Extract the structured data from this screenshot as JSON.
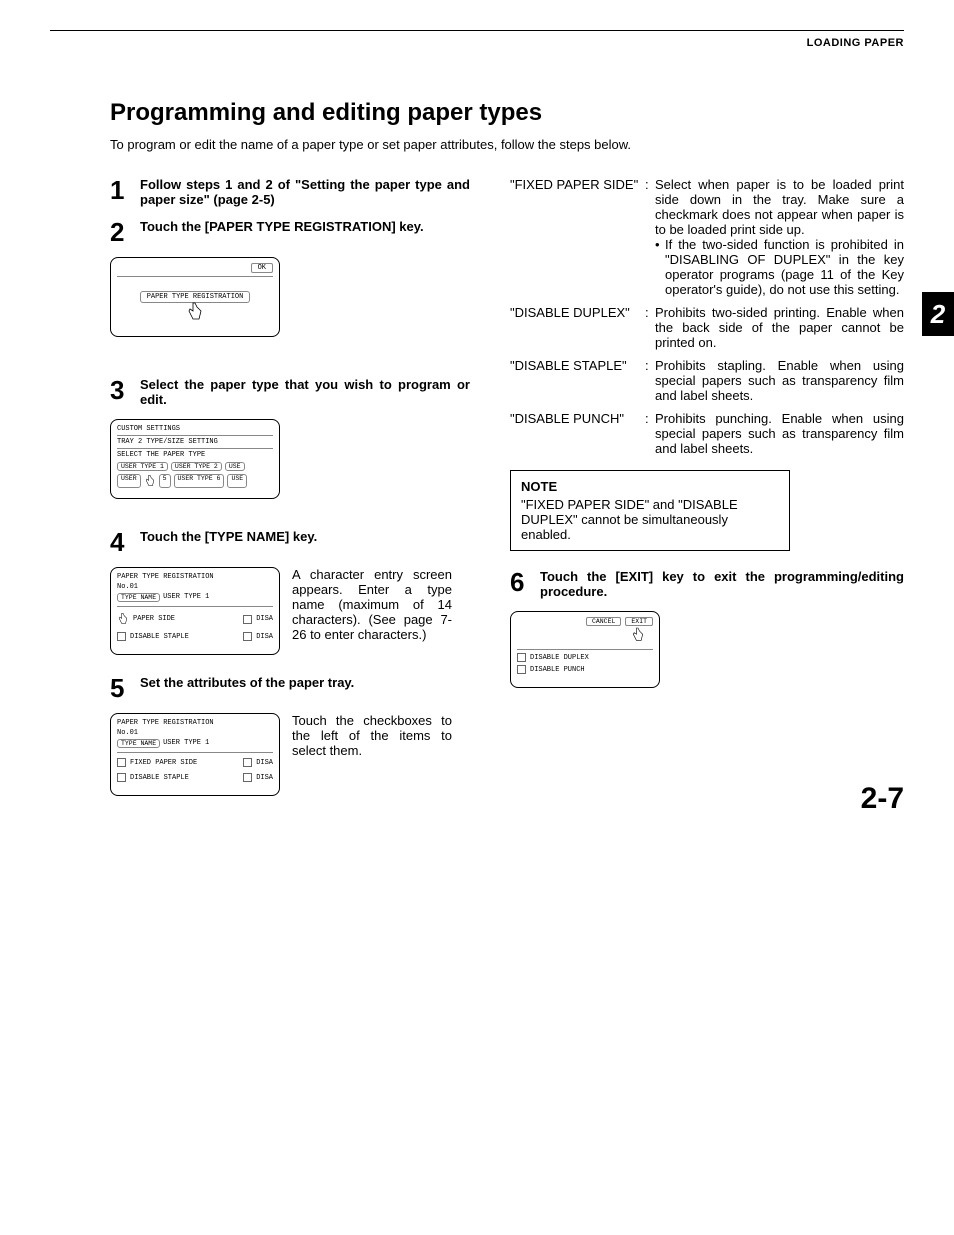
{
  "header": {
    "section": "LOADING PAPER"
  },
  "title": "Programming and editing paper types",
  "intro": "To program or edit the name of a paper type or set paper attributes, follow the steps below.",
  "sideTab": "2",
  "pageNumber": "2-7",
  "steps": {
    "s1": {
      "num": "1",
      "title": "Follow steps 1 and 2 of \"Setting the paper type and paper size\" (page 2-5)"
    },
    "s2": {
      "num": "2",
      "title": "Touch the [PAPER TYPE REGISTRATION] key."
    },
    "s3": {
      "num": "3",
      "title": "Select the paper type that you wish to program or edit."
    },
    "s4": {
      "num": "4",
      "title": "Touch the [TYPE NAME] key.",
      "desc": "A character entry screen appears.\nEnter a type name (maximum of 14 characters). (See page 7-26 to enter characters.)"
    },
    "s5": {
      "num": "5",
      "title": "Set the attributes of the paper tray.",
      "desc": "Touch the checkboxes to the left of the items to select them."
    },
    "s6": {
      "num": "6",
      "title": "Touch the [EXIT] key to exit the programming/editing procedure."
    }
  },
  "dialogs": {
    "d2": {
      "ok": "OK",
      "btn": "PAPER TYPE REGISTRATION"
    },
    "d3": {
      "line1": "CUSTOM SETTINGS",
      "line2": "TRAY 2 TYPE/SIZE SETTING",
      "line3": "SELECT THE PAPER TYPE",
      "btns": [
        "USER TYPE 1",
        "USER TYPE 2",
        "USE",
        "USER",
        "5",
        "USER TYPE 6",
        "USE"
      ]
    },
    "d4": {
      "title": "PAPER TYPE REGISTRATION",
      "no": "No.01",
      "typeNameLabel": "TYPE NAME",
      "typeNameVal": "USER TYPE 1",
      "row1": "PAPER SIDE",
      "row1b": "DISA",
      "row2": "DISABLE STAPLE",
      "row2b": "DISA"
    },
    "d5": {
      "title": "PAPER TYPE REGISTRATION",
      "no": "No.01",
      "typeNameLabel": "TYPE NAME",
      "typeNameVal": "USER TYPE 1",
      "row1": "FIXED PAPER SIDE",
      "row1b": "DISA",
      "row2": "DISABLE STAPLE",
      "row2b": "DISA"
    },
    "d6": {
      "cancel": "CANCEL",
      "exit": "EXIT",
      "row1": "DISABLE DUPLEX",
      "row2": "DISABLE PUNCH"
    }
  },
  "defs": {
    "fixedPaperSide": {
      "term": "\"FIXED PAPER SIDE\"",
      "desc": "Select when paper is to be loaded print side down in the tray. Make sure a checkmark does not appear when paper is to be loaded print side up.",
      "sub": "If the two-sided function is prohibited in \"DISABLING OF DUPLEX\" in the key operator programs (page 11 of the Key operator's guide), do not use this setting."
    },
    "disableDuplex": {
      "term": "\"DISABLE DUPLEX\"",
      "desc": "Prohibits two-sided printing. Enable when the back side of the paper cannot be printed on."
    },
    "disableStaple": {
      "term": "\"DISABLE STAPLE\"",
      "desc": "Prohibits stapling. Enable when using special papers such as transparency film and label sheets."
    },
    "disablePunch": {
      "term": "\"DISABLE PUNCH\"",
      "desc": "Prohibits punching. Enable when using special papers such as transparency film and label sheets."
    }
  },
  "note": {
    "label": "NOTE",
    "text": "\"FIXED PAPER SIDE\" and \"DISABLE DUPLEX\" cannot be simultaneously enabled."
  }
}
